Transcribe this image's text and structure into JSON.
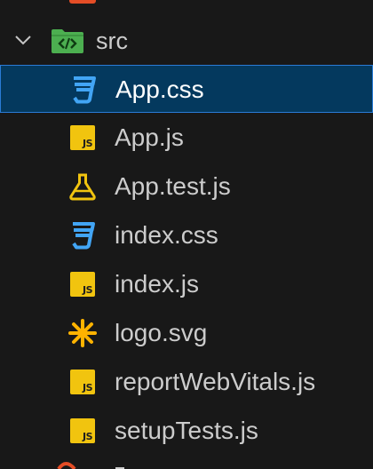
{
  "folder": {
    "name": "src",
    "expanded": true,
    "icon": "folder-src-icon"
  },
  "files": [
    {
      "name": "App.css",
      "icon": "css-icon",
      "selected": true
    },
    {
      "name": "App.js",
      "icon": "js-icon",
      "selected": false
    },
    {
      "name": "App.test.js",
      "icon": "test-flask-icon",
      "selected": false
    },
    {
      "name": "index.css",
      "icon": "css-icon",
      "selected": false
    },
    {
      "name": "index.js",
      "icon": "js-icon",
      "selected": false
    },
    {
      "name": "logo.svg",
      "icon": "svg-asterisk-icon",
      "selected": false
    },
    {
      "name": "reportWebVitals.js",
      "icon": "js-icon",
      "selected": false
    },
    {
      "name": "setupTests.js",
      "icon": "js-icon",
      "selected": false
    }
  ],
  "colors": {
    "background": "#181818",
    "selection_bg": "#04395e",
    "selection_border": "#2a7bd6",
    "css_icon": "#42a5f5",
    "js_icon": "#f1c40f",
    "test_icon": "#f1c40f",
    "svg_icon": "#ffb300",
    "folder_icon": "#4caf50",
    "text": "#cccccc"
  },
  "js_badge_text": "JS"
}
